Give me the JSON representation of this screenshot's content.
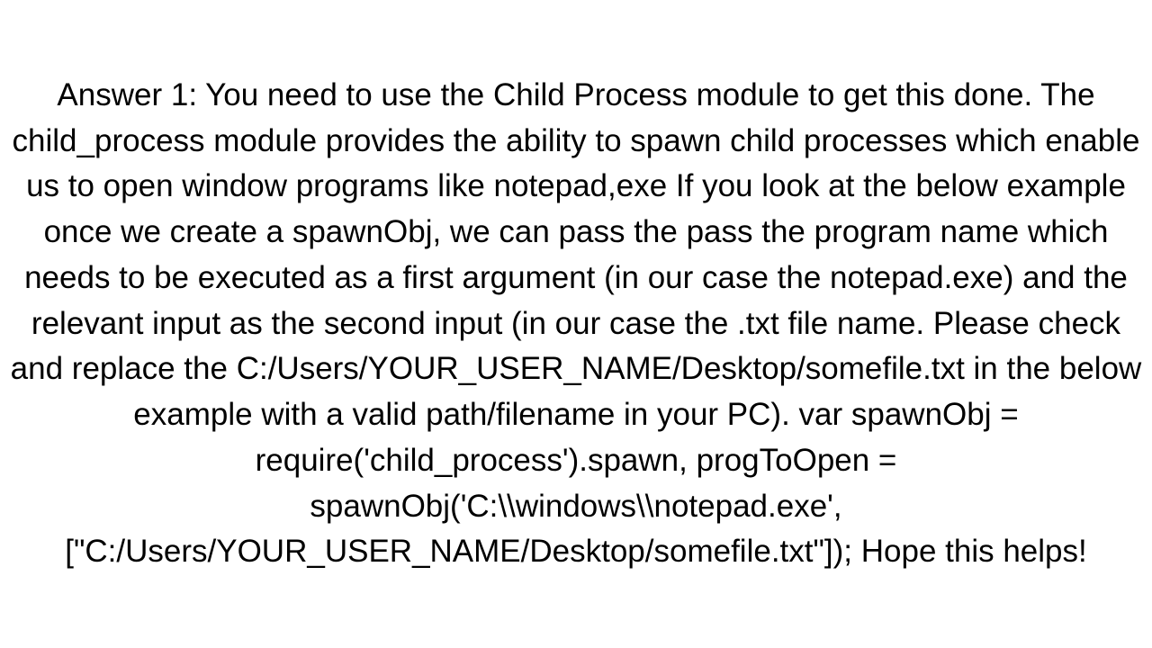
{
  "answer": {
    "text": "Answer 1: You need to use the Child Process module to get this done. The child_process module provides the ability to spawn child processes which enable us to open window programs like notepad,exe If you look at the below example once we create a spawnObj, we can pass the pass the program name which needs to be executed as a first argument (in our case the notepad.exe) and the relevant input as the second input (in our case the .txt file name. Please check and replace the C:/Users/YOUR_USER_NAME/Desktop/somefile.txt in the below example with a valid path/filename in your PC).  var spawnObj = require('child_process').spawn, progToOpen = spawnObj('C:\\\\windows\\\\notepad.exe', [\"C:/Users/YOUR_USER_NAME/Desktop/somefile.txt\"]);  Hope this helps!"
  }
}
